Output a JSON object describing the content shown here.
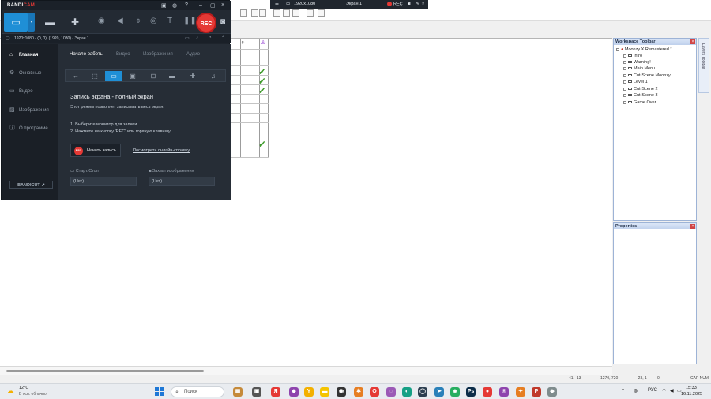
{
  "bandicam": {
    "logo_main": "BANDI",
    "logo_accent": "CAM",
    "rec_label": "REC",
    "region_text": "1920x1080 - (0, 0), (1920, 1080) - Экран 1",
    "sidebar": [
      {
        "label": "Главная",
        "icon": "home-icon",
        "active": true
      },
      {
        "label": "Основные",
        "icon": "gear-icon",
        "active": false
      },
      {
        "label": "Видео",
        "icon": "video-icon",
        "active": false
      },
      {
        "label": "Изображения",
        "icon": "image-icon",
        "active": false
      },
      {
        "label": "О программе",
        "icon": "info-icon",
        "active": false
      }
    ],
    "bandicut_label": "BANDICUT ↗",
    "tabs": [
      {
        "label": "Начало работы",
        "active": true
      },
      {
        "label": "Видео",
        "active": false
      },
      {
        "label": "Изображения",
        "active": false
      },
      {
        "label": "Аудио",
        "active": false
      }
    ],
    "heading": "Запись экрана - полный экран",
    "description": "Этот режим позволяет записывать весь экран.",
    "step1": "1. Выберите монитор для записи.",
    "step2": "2. Нажмите на кнопку 'REC' или горячую клавишу.",
    "start_button": "Начать запись",
    "start_rec_dot": "REC",
    "help_link": "Посмотреть онлайн-справку",
    "hotkey_start_stop_label": "Старт/Стоп",
    "hotkey_start_stop_value": "(Нет)",
    "hotkey_capture_label": "Захват изображения",
    "hotkey_capture_value": "(Нет)"
  },
  "overlay_bar": {
    "resolution": "1920x1080",
    "screen": "Экран 1",
    "rec": "REC"
  },
  "workspace": {
    "title": "Workspace Toolbar",
    "root": "Moonzy X Remastered *",
    "items": [
      "Intro",
      "Warning!",
      "Main Menu",
      "Cut-Scene Moonzy",
      "Level 1",
      "Cut-Scene 2",
      "Cut-Scene 3",
      "Game Over"
    ],
    "layers_tab": "Layers Toolbar"
  },
  "properties": {
    "title": "Properties"
  },
  "statusbar": {
    "cursor": "41, -13",
    "size": "1270, 720",
    "offset": "-23, 1",
    "layer": "0",
    "keys": "CAP NUM"
  },
  "taskbar": {
    "weather_temp": "12°C",
    "weather_desc": "В осн. облачно",
    "search_placeholder": "Поиск",
    "language": "РУС",
    "time": "15:33",
    "date": "16.11.2025"
  },
  "colors": {
    "accent_blue": "#1f8fd6",
    "rec_red": "#e53935",
    "check_green": "#3d9a2a"
  }
}
